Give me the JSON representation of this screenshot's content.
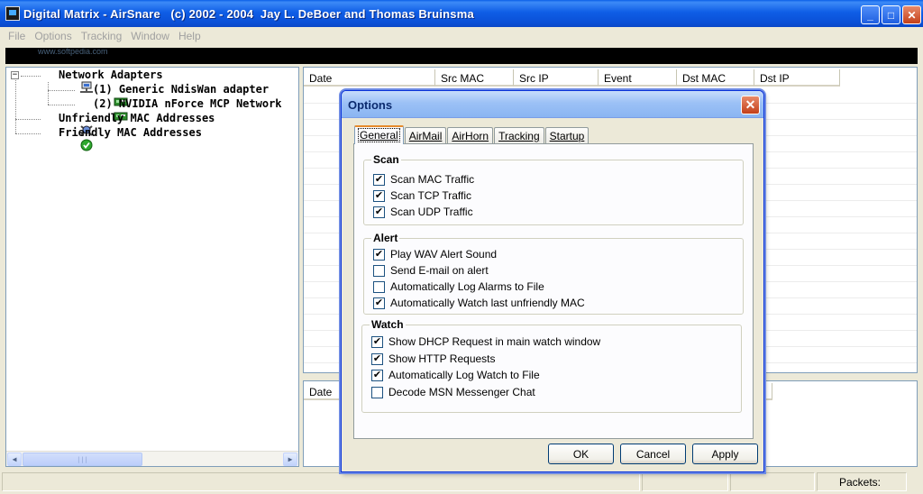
{
  "window": {
    "title": "Digital Matrix - AirSnare   (c) 2002 - 2004  Jay L. DeBoer and Thomas Bruinsma",
    "minimize": "_",
    "maximize": "□",
    "close": "✕"
  },
  "watermark": "www.softpedia.com",
  "menu": {
    "items": [
      "File",
      "Options",
      "Tracking",
      "Window",
      "Help"
    ]
  },
  "tree": {
    "expander": "−",
    "root_label": "Network Adapters",
    "adapters": [
      "(1) Generic NdisWan adapter",
      "(2) NVIDIA nForce MCP Network"
    ],
    "unfriendly_label": "Unfriendly MAC Addresses",
    "friendly_label": "Friendly MAC Addresses",
    "scroll_left": "◀",
    "scroll_right": "▶",
    "scroll_thumb": "|||"
  },
  "listview": {
    "columns": [
      "Date",
      "Src MAC",
      "Src IP",
      "Event",
      "Dst MAC",
      "Dst IP"
    ]
  },
  "listview2": {
    "columns": [
      "Date"
    ]
  },
  "statusbar": {
    "packets_label": "Packets:"
  },
  "dialog": {
    "title": "Options",
    "close": "✕",
    "tabs": [
      "General",
      "AirMail",
      "AirHorn",
      "Tracking",
      "Startup"
    ],
    "active_tab": "General",
    "groups": {
      "scan": {
        "title": "Scan",
        "items": [
          {
            "label": "Scan MAC Traffic",
            "checked": true
          },
          {
            "label": "Scan TCP Traffic",
            "checked": true
          },
          {
            "label": "Scan UDP Traffic",
            "checked": true
          }
        ]
      },
      "alert": {
        "title": "Alert",
        "items": [
          {
            "label": "Play WAV Alert Sound",
            "checked": true
          },
          {
            "label": "Send E-mail on alert",
            "checked": false
          },
          {
            "label": "Automatically Log Alarms to File",
            "checked": false
          },
          {
            "label": "Automatically Watch last unfriendly MAC",
            "checked": true
          }
        ]
      },
      "watch": {
        "title": "Watch",
        "items": [
          {
            "label": "Show DHCP Request in main watch window",
            "checked": true
          },
          {
            "label": "Show HTTP Requests",
            "checked": true
          },
          {
            "label": "Automatically Log Watch to File",
            "checked": true
          },
          {
            "label": "Decode MSN Messenger Chat",
            "checked": false
          }
        ]
      }
    },
    "buttons": {
      "ok": "OK",
      "cancel": "Cancel",
      "apply": "Apply"
    }
  }
}
